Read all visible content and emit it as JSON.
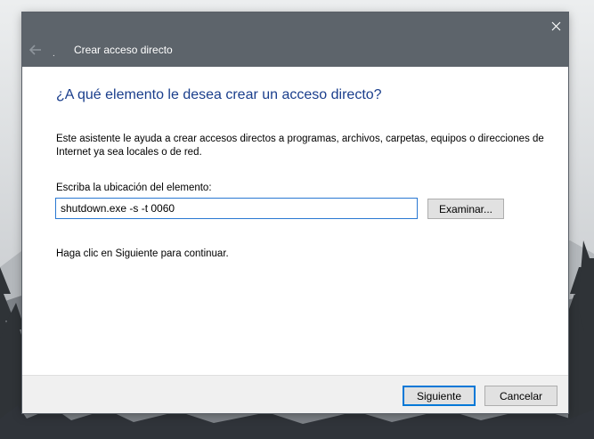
{
  "window": {
    "title": "Crear acceso directo",
    "back_icon": "back-arrow-icon",
    "close_icon": "close-icon",
    "app_icon": "shortcut-icon"
  },
  "main": {
    "heading": "¿A qué elemento le desea crear un acceso directo?",
    "description": "Este asistente le ayuda a crear accesos directos a programas, archivos, carpetas, equipos o direcciones de Internet ya sea locales o de red.",
    "location_label": "Escriba la ubicación del elemento:",
    "location_value": "shutdown.exe -s -t 0060",
    "browse_label": "Examinar...",
    "hint": "Haga clic en Siguiente para continuar."
  },
  "footer": {
    "next_label": "Siguiente",
    "cancel_label": "Cancelar"
  },
  "colors": {
    "titlebar": "#5d646b",
    "heading": "#1a3e8c",
    "focus_border": "#0078d7"
  }
}
